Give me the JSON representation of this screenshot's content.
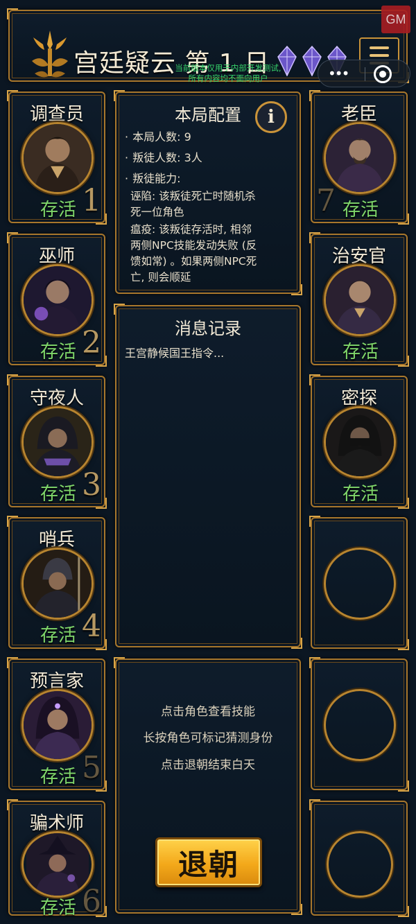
{
  "header": {
    "title": "宫廷疑云 第 1 日",
    "dev_notice_line1": "当前版本仅用于内部开发测试,",
    "dev_notice_line2": "所有内容均不面向用户",
    "gm_label": "GM",
    "gem_count": 3
  },
  "left_roster": [
    {
      "name": "调查员",
      "status": "存活",
      "seat": "1"
    },
    {
      "name": "巫师",
      "status": "存活",
      "seat": "2"
    },
    {
      "name": "守夜人",
      "status": "存活",
      "seat": "3"
    },
    {
      "name": "哨兵",
      "status": "存活",
      "seat": "4"
    },
    {
      "name": "预言家",
      "status": "存活",
      "seat": "5"
    },
    {
      "name": "骗术师",
      "status": "存活",
      "seat": "6"
    }
  ],
  "right_roster": [
    {
      "name": "老臣",
      "status": "存活",
      "seat": "7"
    },
    {
      "name": "治安官",
      "status": "存活",
      "seat": ""
    },
    {
      "name": "密探",
      "status": "存活",
      "seat": ""
    }
  ],
  "config": {
    "title": "本局配置",
    "info_icon": "i",
    "players_line": "本局人数: 9",
    "traitors_line": "叛徒人数: 3人",
    "ability_heading": "叛徒能力:",
    "ability_1_line1": "诬陷: 该叛徒死亡时随机杀",
    "ability_1_line2": "死一位角色",
    "ability_2_line1": "瘟疫: 该叛徒存活时, 相邻",
    "ability_2_line2": "两侧NPC技能发动失败 (反",
    "ability_2_line3": "馈如常) 。如果两侧NPC死",
    "ability_2_line4": "亡, 则会顺延"
  },
  "log": {
    "title": "消息记录",
    "entry": "王宫静候国王指令..."
  },
  "hints": {
    "hint_1": "点击角色查看技能",
    "hint_2": "长按角色可标记猜测身份",
    "hint_3": "点击退朝结束白天",
    "exit_button": "退朝"
  },
  "colors": {
    "gold_border": "#a8772c",
    "alive_green": "#7fd66a",
    "background": "#0b1622",
    "button_gold": "#f3a81a"
  }
}
